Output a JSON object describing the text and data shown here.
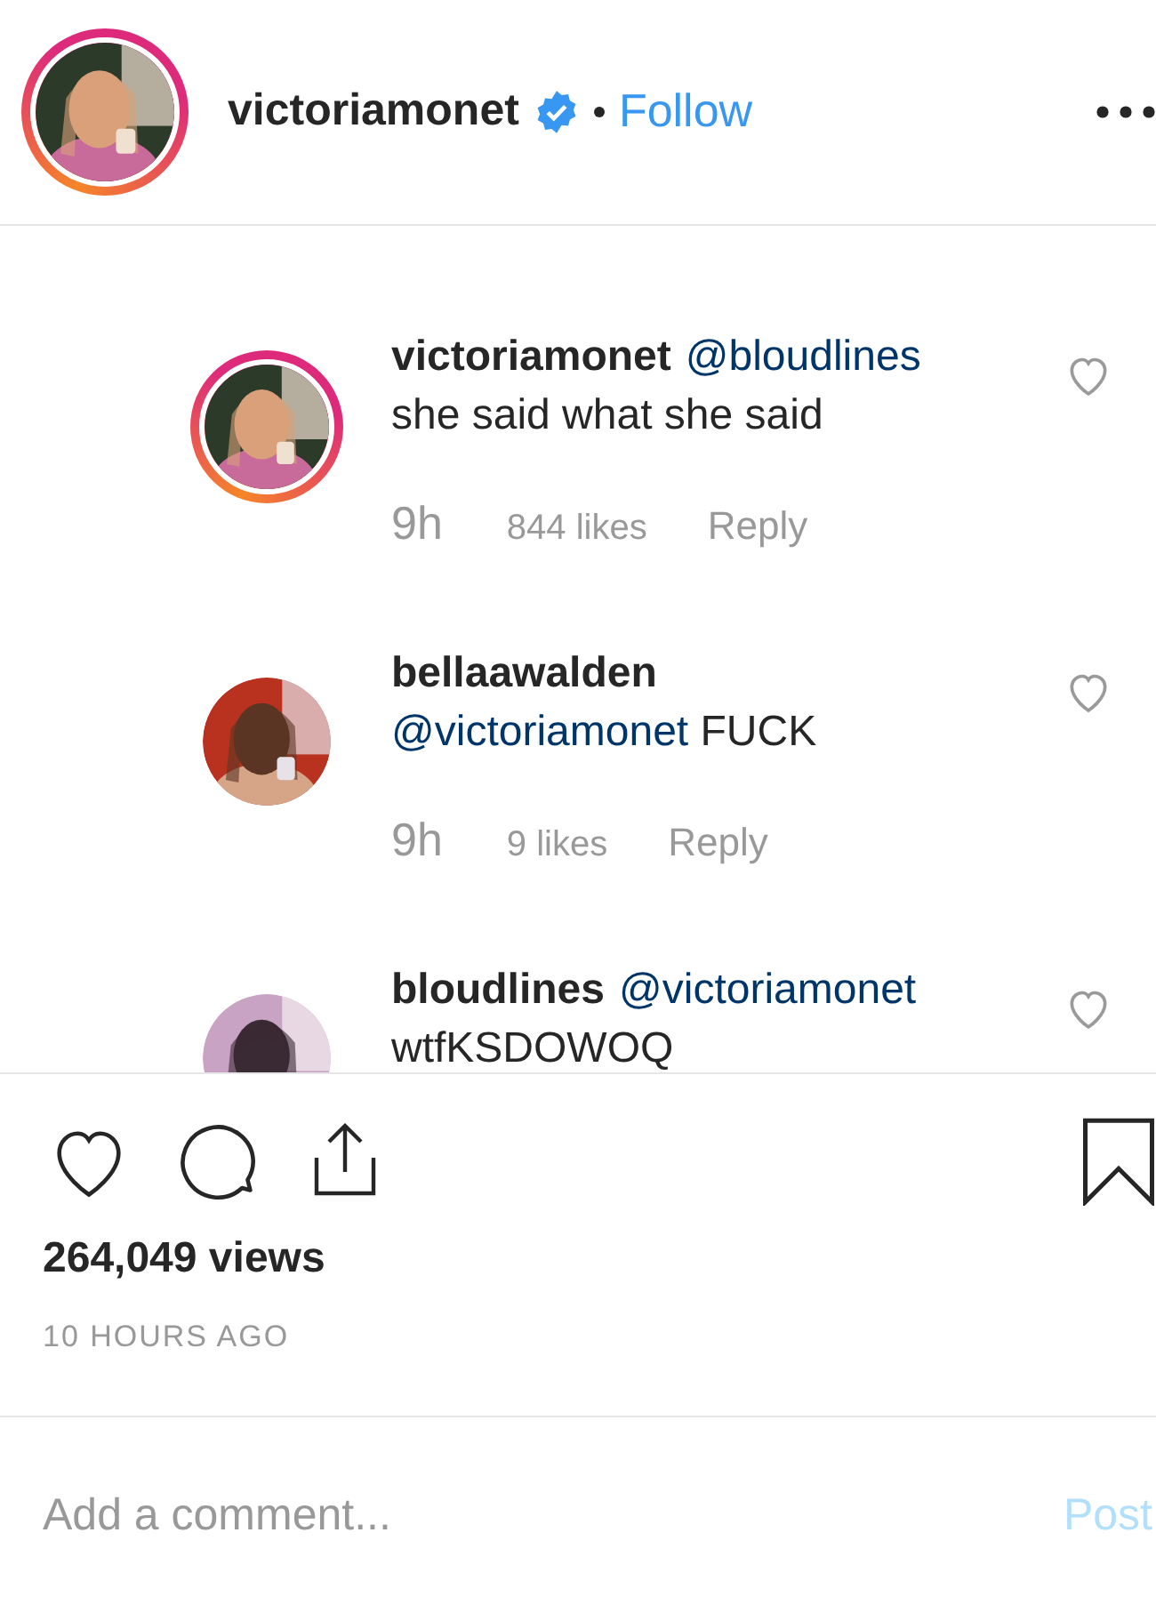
{
  "header": {
    "username": "victoriamonet",
    "verified": true,
    "story_ring": true,
    "follow": "Follow"
  },
  "comments": [
    {
      "username": "victoriamonet",
      "story_ring": true,
      "reply_to": "@bloudlines",
      "text": [
        {
          "kind": "plain",
          "text": "she said what she said"
        }
      ],
      "time": "9h",
      "likes": "844 likes",
      "reply": "Reply",
      "liked": false
    },
    {
      "username": "bellaawalden",
      "story_ring": false,
      "text": [
        {
          "kind": "mention",
          "text": "@victoriamonet"
        },
        {
          "kind": "plain",
          "text": " FUCK"
        }
      ],
      "time": "9h",
      "likes": "9 likes",
      "reply": "Reply",
      "liked": false
    },
    {
      "username": "bloudlines",
      "story_ring": false,
      "reply_to": "@victoriamonet",
      "text": [
        {
          "kind": "plain",
          "text": "wtfKSDOWOQ"
        }
      ],
      "liked": false
    }
  ],
  "actions": {
    "liked": false,
    "saved": false,
    "views": "264,049 views",
    "posted": "10 HOURS AGO"
  },
  "composer": {
    "placeholder": "Add a comment...",
    "post": "Post",
    "disabled": true
  }
}
